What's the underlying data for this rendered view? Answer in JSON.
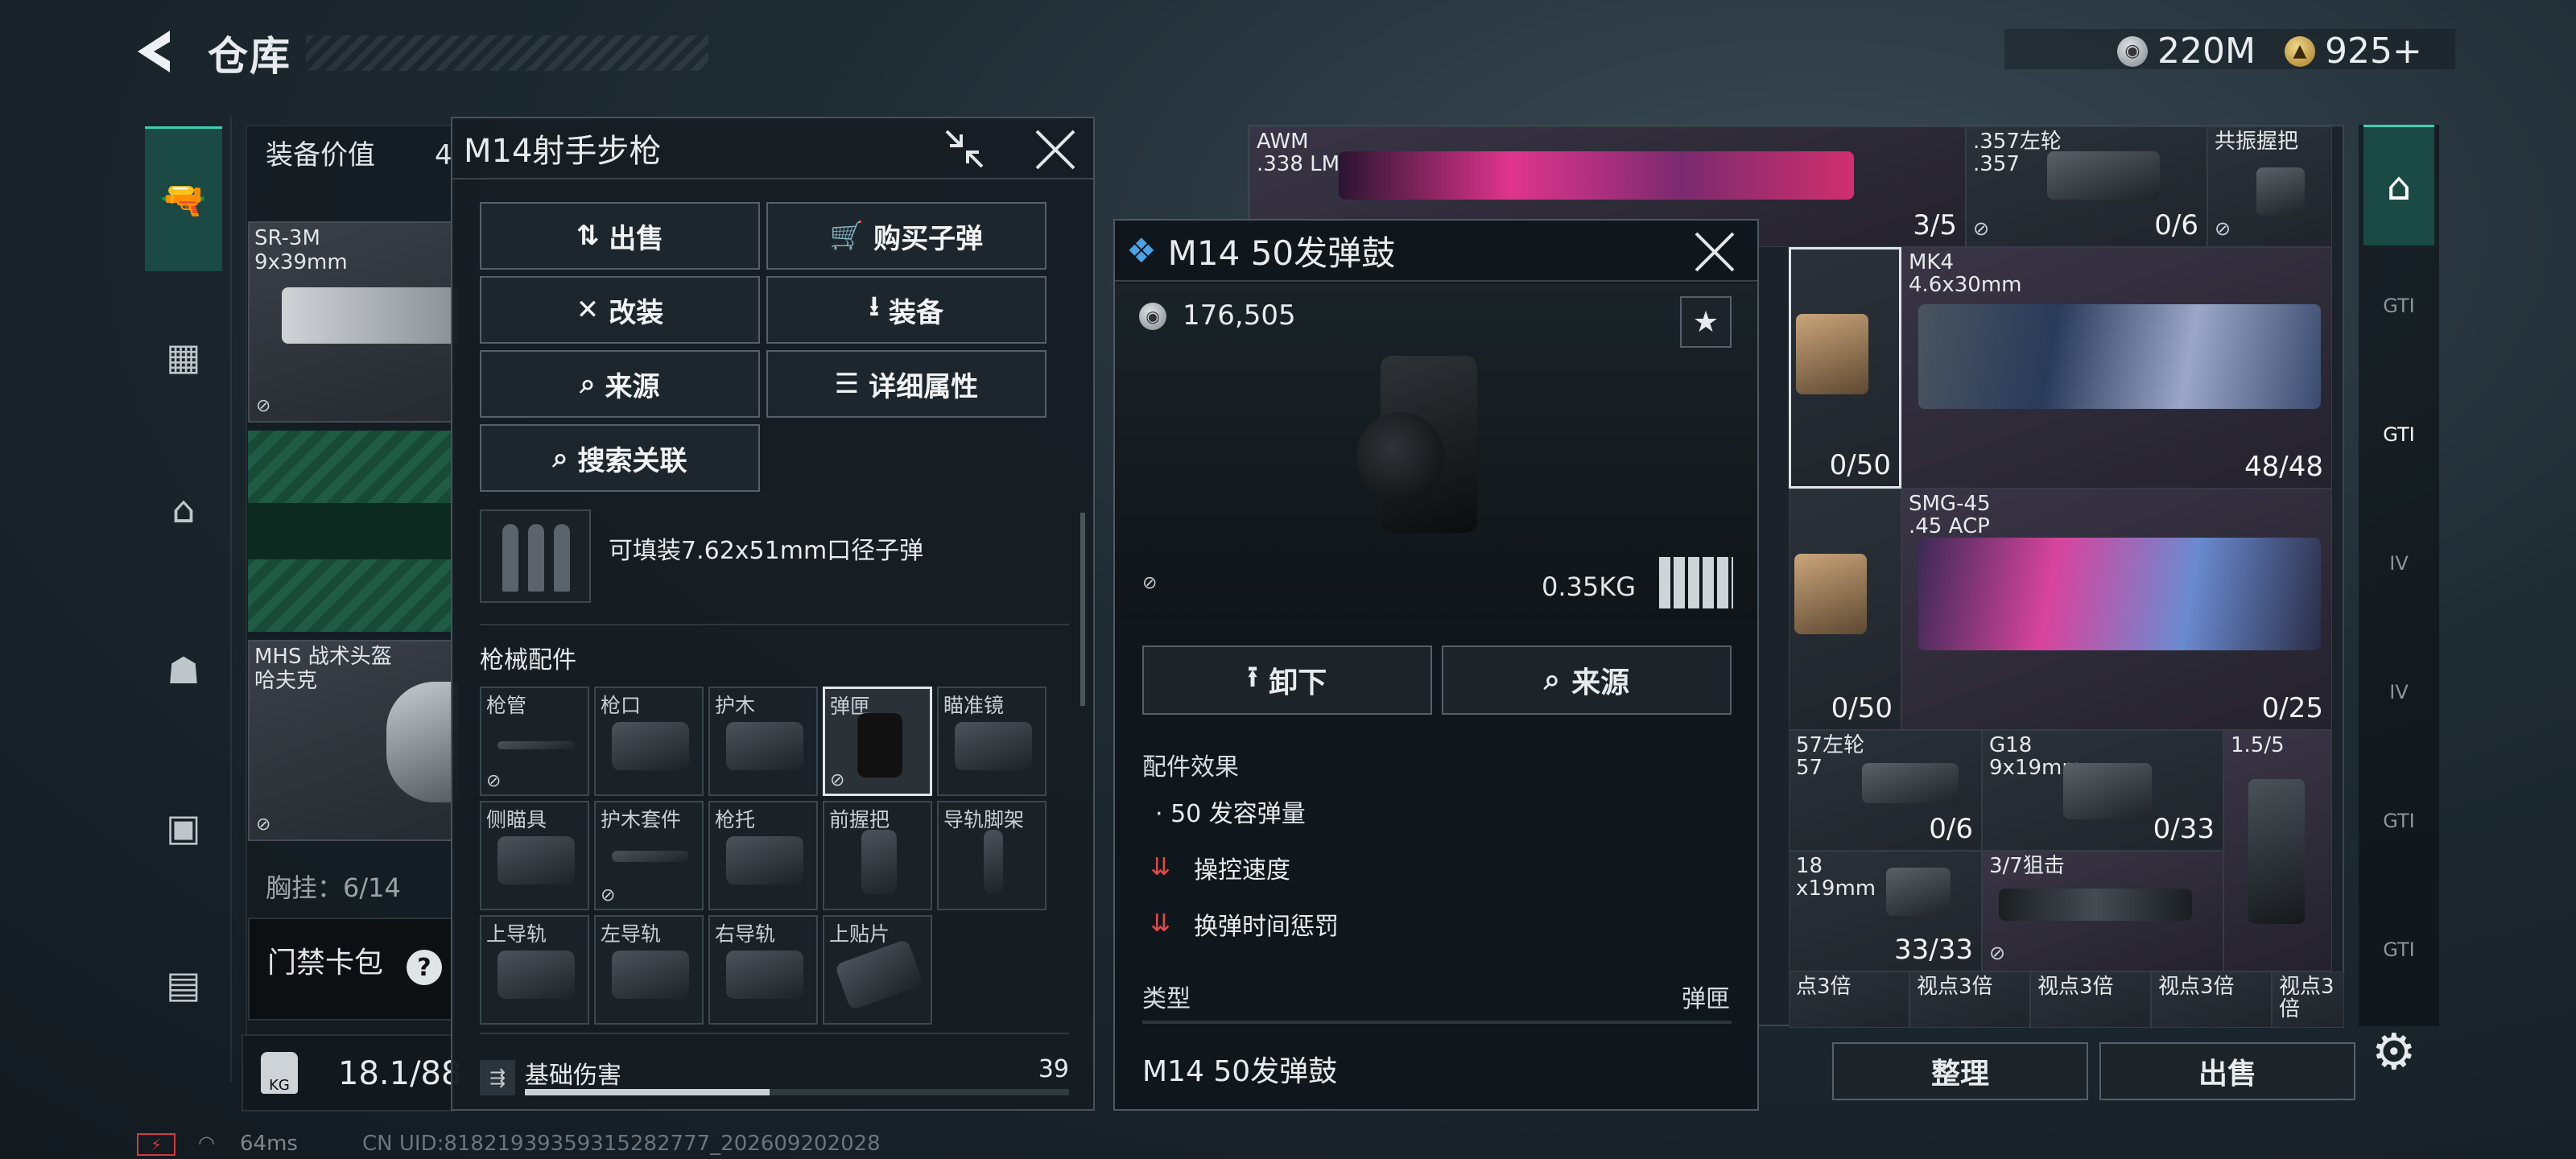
{
  "header": {
    "title": "仓库",
    "currencies": [
      {
        "icon": "silver-coin-icon",
        "value": "220M"
      },
      {
        "icon": "gold-coin-icon",
        "value": "925+"
      }
    ]
  },
  "left_panel": {
    "equipment_value_label": "装备价值",
    "equipment_value_partial": "4",
    "items": [
      {
        "name": "SR-3M",
        "sub": "9x39mm"
      },
      {
        "name": "MHS 战术头盔",
        "sub": "哈夫克"
      }
    ],
    "chest_rig_partial": "胸挂：6/14",
    "keycard_label": "门禁卡包",
    "keycard_help": "?",
    "weight": "18.1/88"
  },
  "status_bar": {
    "ping": "64ms",
    "uid": "CN UID:8182193935931528​2777_202609202028"
  },
  "weapon_modal": {
    "title": "M14射手步枪",
    "buttons": [
      {
        "label": "出售",
        "icon": "sell-icon"
      },
      {
        "label": "购买子弹",
        "icon": "cart-icon"
      },
      {
        "label": "改装",
        "icon": "wrench-icon"
      },
      {
        "label": "装备",
        "icon": "download-icon"
      },
      {
        "label": "来源",
        "icon": "search-icon"
      },
      {
        "label": "详细属性",
        "icon": "list-icon"
      },
      {
        "label": "搜索关联",
        "icon": "search-icon"
      }
    ],
    "ammo_text": "可填装7.62x51mm口径子弹",
    "attachments_title": "枪械配件",
    "slots": [
      "枪管",
      "枪口",
      "护木",
      "弹匣",
      "瞄准镜",
      "侧瞄具",
      "护木套件",
      "枪托",
      "前握把",
      "导轨脚架",
      "上导轨",
      "左导轨",
      "右导轨",
      "上贴片"
    ],
    "stat_label": "基础伤害",
    "stat_value": "39",
    "stat_fraction": 0.45
  },
  "detail_popup": {
    "title": "M14 50发弹鼓",
    "price": "176,505",
    "weight": "0.35KG",
    "buttons": [
      {
        "label": "卸下",
        "icon": "upload-icon"
      },
      {
        "label": "来源",
        "icon": "search-icon"
      }
    ],
    "effects_title": "配件效果",
    "effects": [
      "· 50 发容弹量",
      "操控速度",
      "换弹时间惩罚"
    ],
    "type_label": "类型",
    "type_value": "弹匣",
    "bottom_name": "M14 50发弹鼓"
  },
  "grid": {
    "cells": [
      {
        "name": "AWM\n.338 LM",
        "count": "3/5"
      },
      {
        "name": ".357左轮\n.357",
        "count": "0/6"
      },
      {
        "name": "共振握把",
        "count": ""
      },
      {
        "name": "MK4\n4.6x30mm",
        "count": "48/48"
      },
      {
        "name": "",
        "count": "0/50"
      },
      {
        "name": "SMG-45\n.45 ACP",
        "count": "0/25"
      },
      {
        "name": "",
        "count": "0/50"
      },
      {
        "name": "57左轮\n57",
        "count": "0/6"
      },
      {
        "name": "G18\n9x19mm",
        "count": "0/33"
      },
      {
        "name": "1.5/5",
        "count": ""
      },
      {
        "name": "18\nx19mm",
        "count": "33/33"
      },
      {
        "name": "3/7狙击",
        "count": ""
      }
    ],
    "scope_labels": [
      "点3倍",
      "视点3倍",
      "视点3倍",
      "视点3倍",
      "视点3倍"
    ],
    "bottom_buttons": [
      "整理",
      "出售"
    ]
  },
  "right_sidebar": {
    "tabs": [
      "GTI",
      "GTI",
      "IV",
      "IV",
      "GTI",
      "GTI"
    ]
  }
}
